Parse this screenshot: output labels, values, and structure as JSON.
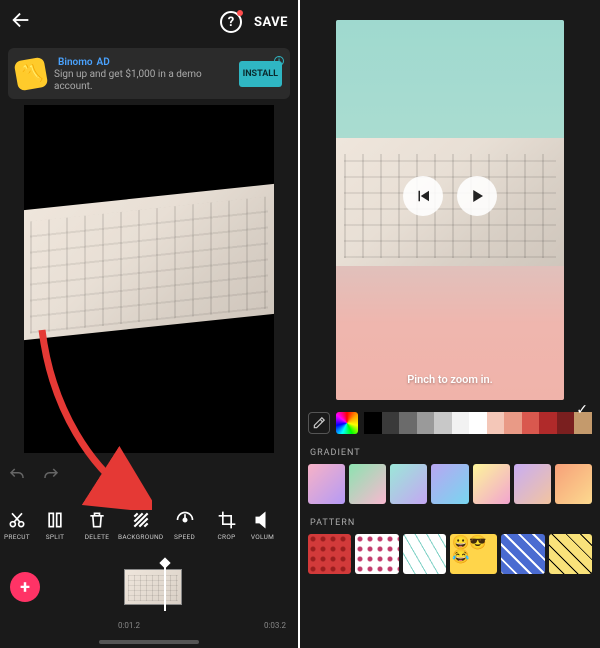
{
  "left": {
    "save_label": "SAVE",
    "ad": {
      "brand": "Binomo",
      "tag": "AD",
      "sub": "Sign up and get $1,000 in a demo account.",
      "cta": "INSTALL"
    },
    "tools": {
      "precut": "PRECUT",
      "split": "SPLIT",
      "delete": "DELETE",
      "background": "BACKGROUND",
      "speed": "SPEED",
      "crop": "CROP",
      "volume": "VOLUM"
    },
    "timeline": {
      "current": "0:01.2",
      "total": "0:03.2",
      "add": "+"
    }
  },
  "right": {
    "hint": "Pinch to zoom in.",
    "section_gradient": "GRADIENT",
    "section_pattern": "PATTERN",
    "solid_colors": [
      "#000000",
      "#3a3a3a",
      "#6b6b6b",
      "#9a9a9a",
      "#c8c8c8",
      "#f2f2f2",
      "#ffffff",
      "#f4c7b8",
      "#e99a86",
      "#d9584e",
      "#b02a2a",
      "#7a1f1f",
      "#c49a6c"
    ],
    "gradients": [
      [
        "#f7b2c6",
        "#b49af5"
      ],
      [
        "#8ce3b0",
        "#f9b8d0"
      ],
      [
        "#9be7d8",
        "#c4a6f2"
      ],
      [
        "#b8a6f1",
        "#78d6f0"
      ],
      [
        "#fdf59a",
        "#f2a4cf"
      ],
      [
        "#c8adf3",
        "#f2c4a0"
      ],
      [
        "#f7a079",
        "#fcd98f"
      ]
    ],
    "patterns": [
      {
        "bg": "#d23a3a",
        "fg": "#9a1f1f",
        "type": "dots"
      },
      {
        "bg": "#ffffff",
        "fg": "#c23a6b",
        "type": "dots"
      },
      {
        "bg": "#ffffff",
        "fg": "#7fd1c6",
        "type": "hex"
      },
      {
        "bg": "#ffd54a",
        "fg": "#000000",
        "type": "emoji"
      },
      {
        "bg": "#4a6bd1",
        "fg": "#ffffff",
        "type": "cross"
      },
      {
        "bg": "#f9e27a",
        "fg": "#000000",
        "type": "tri"
      }
    ]
  }
}
